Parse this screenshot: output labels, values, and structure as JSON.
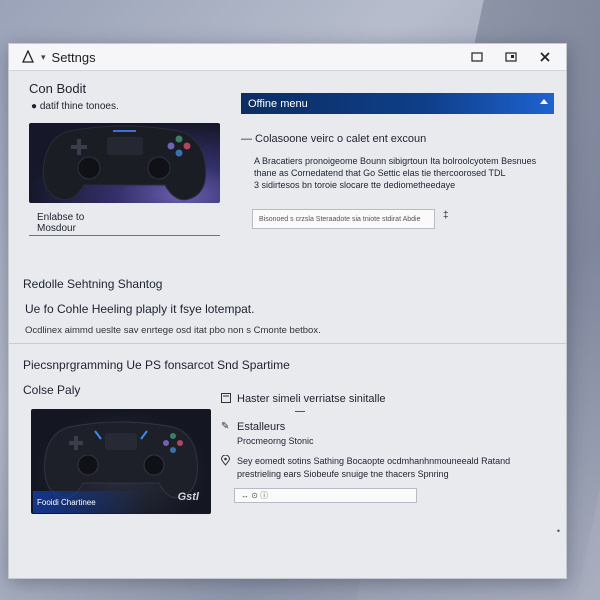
{
  "window": {
    "title": "Settngs",
    "chevron": "▾",
    "controls": [
      "minimize-icon",
      "restore-icon",
      "close-icon"
    ]
  },
  "left_top": {
    "heading": "Con Bodit",
    "bullet": "● datif thine tonoes.",
    "card_caption_line1": "Enlabse to",
    "card_caption_line2": "Mosdour"
  },
  "right_top": {
    "dropdown_label": "Offine menu",
    "section_title": "— Colasoone veirc o calet ent excoun",
    "desc_line1": "A Bracatiers pronoigeome Bounn sibigrtoun Ita bolroolcyotem Besnues",
    "desc_line2": "thane as Cornedatend that Go Settic elas tie thercoorosed TDL",
    "desc_line3": "3 sidirtesos bn toroie slocare tte dediometheedaye",
    "input_text": "Bisonoed s crzsla Steraadote sia tniote stdirat Abdie",
    "input_suffix": "‡"
  },
  "middle": {
    "heading": "Redolle Sehtning Shantog",
    "subheading": "Ue fo Cohle Heeling plaply it fsye lotempat.",
    "description": "Ocdlinex aimmd ueslte sav enrtege osd itat pbo non s Cmonte betbox."
  },
  "lower": {
    "section_title": "Piecsnprgramming Ue PS fonsarcot Snd Spartime",
    "subheading": "Colse Paly",
    "card_caption": "Fooidi Chartinee",
    "card_brand": "Gstl",
    "row1_icon": "checkbox-icon",
    "row1_label": "Haster simeli verriatse sinitalle",
    "row2_icon": "pencil-icon",
    "row2_title": "Estalleurs",
    "row2_sub": "Procmeorng Stonic",
    "row3_icon": "location-icon",
    "row3_line1": "Sey eomedt sotins Sathing Bocaopte ocdmhanhnmouneeald Ratand",
    "row3_line2": "prestrieling ears Siobeufe snuige tne thacers Spnring",
    "select_text": "↔ ⊙ ⓘ"
  },
  "colors": {
    "accent_blue": "#0f3f8a",
    "window_bg": "#e9eaee"
  }
}
